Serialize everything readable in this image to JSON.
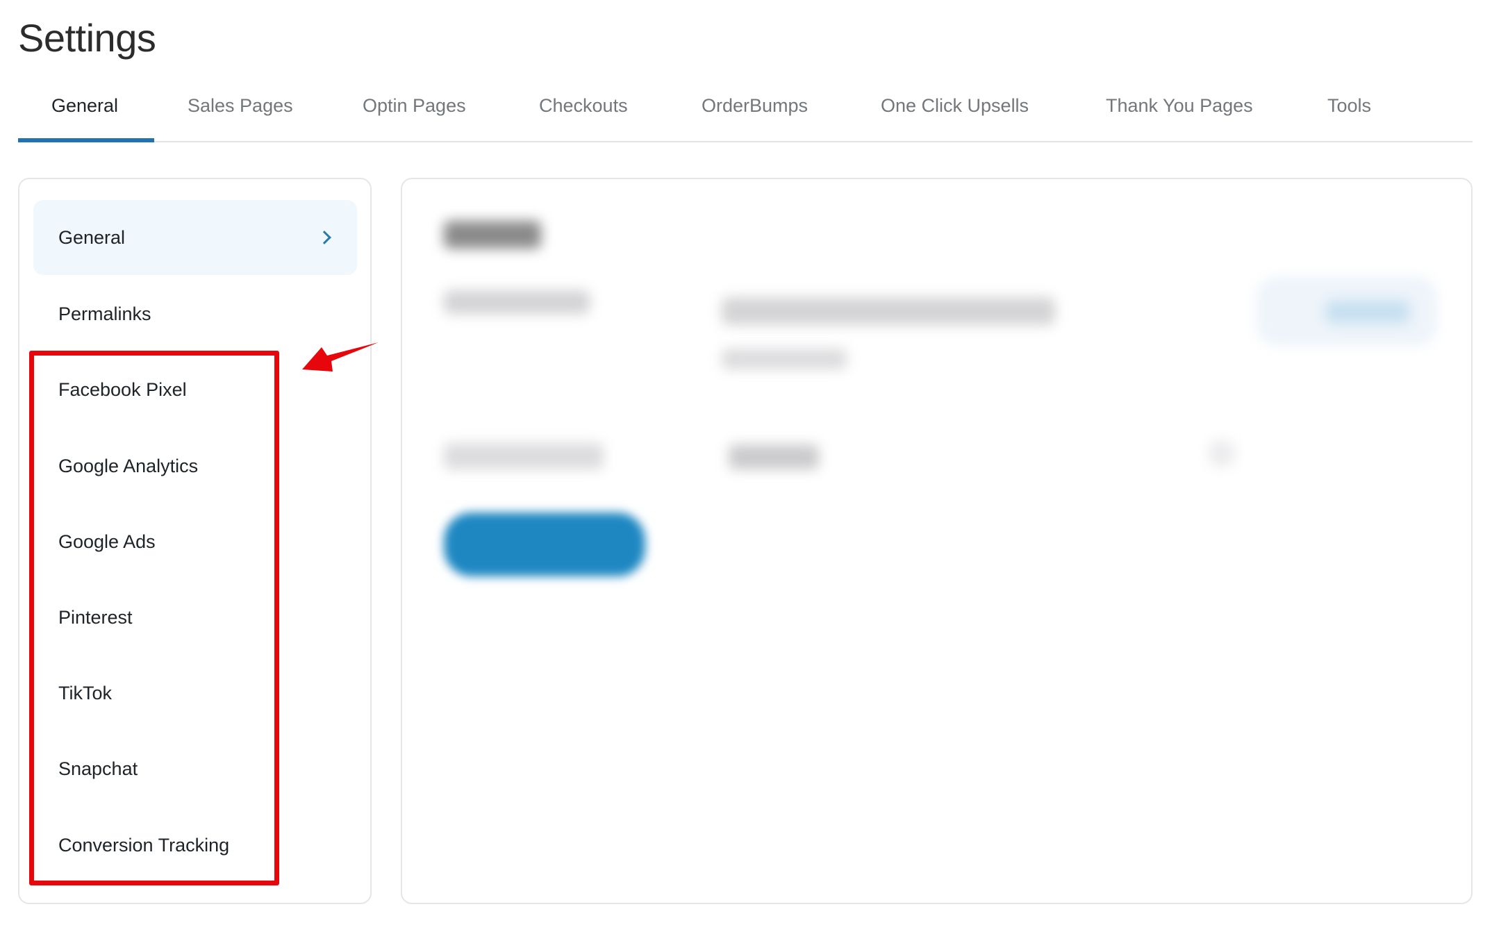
{
  "page": {
    "title": "Settings"
  },
  "tabs": [
    {
      "label": "General",
      "active": true
    },
    {
      "label": "Sales Pages",
      "active": false
    },
    {
      "label": "Optin Pages",
      "active": false
    },
    {
      "label": "Checkouts",
      "active": false
    },
    {
      "label": "OrderBumps",
      "active": false
    },
    {
      "label": "One Click Upsells",
      "active": false
    },
    {
      "label": "Thank You Pages",
      "active": false
    },
    {
      "label": "Tools",
      "active": false
    }
  ],
  "sidebar": {
    "items": [
      {
        "label": "General",
        "active": true,
        "icon": "chevron-right-icon"
      },
      {
        "label": "Permalinks",
        "active": false
      },
      {
        "label": "Facebook Pixel",
        "active": false,
        "highlighted": true
      },
      {
        "label": "Google Analytics",
        "active": false,
        "highlighted": true
      },
      {
        "label": "Google Ads",
        "active": false,
        "highlighted": true
      },
      {
        "label": "Pinterest",
        "active": false,
        "highlighted": true
      },
      {
        "label": "TikTok",
        "active": false,
        "highlighted": true
      },
      {
        "label": "Snapchat",
        "active": false,
        "highlighted": true
      },
      {
        "label": "Conversion Tracking",
        "active": false,
        "highlighted": true
      }
    ]
  },
  "main": {
    "content_state": "blurred"
  },
  "annotation": {
    "type": "red-box-with-arrow",
    "color": "#e8060d"
  },
  "colors": {
    "accent": "#2271b1",
    "active_item_bg": "#f0f7fd",
    "annotation_red": "#e8060d"
  }
}
